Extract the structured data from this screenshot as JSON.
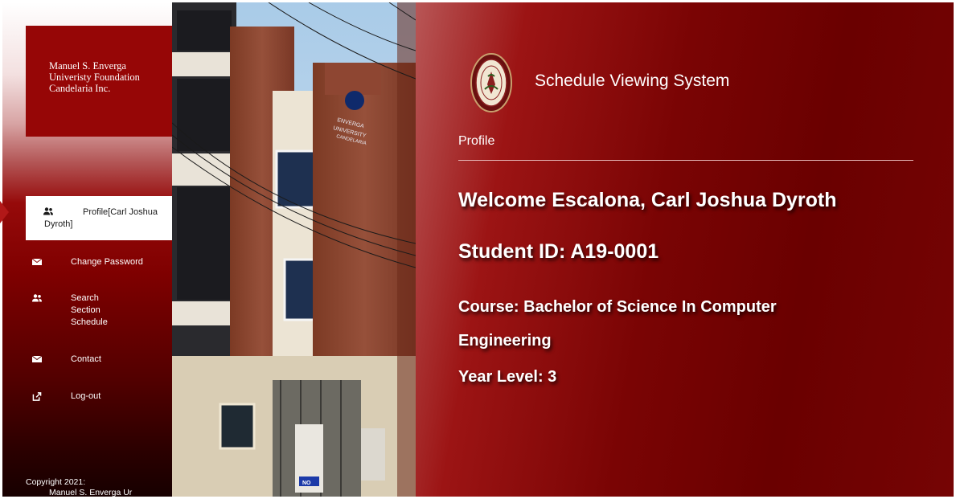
{
  "sidebar": {
    "brand_lines": [
      "Manuel S. Enverga",
      "Univeristy Foundation",
      "Candelaria Inc."
    ],
    "nav": [
      {
        "icon": "users-icon",
        "label_line1": "Profile[Carl Joshua",
        "label_line2": "Dyroth]",
        "active": true
      },
      {
        "icon": "envelope-icon",
        "label": "Change Password"
      },
      {
        "icon": "users-icon",
        "label_lines": [
          "Search",
          "Section",
          "Schedule"
        ]
      },
      {
        "icon": "envelope-icon",
        "label": "Contact"
      },
      {
        "icon": "external-link-icon",
        "label": "Log-out"
      }
    ],
    "copyright_lines": [
      "Copyright 2021:",
      "Manuel S. Enverga Ur"
    ]
  },
  "photo": {
    "building_sign": [
      "ENVERGA",
      "UNIVERSITY",
      "CANDELARIA"
    ],
    "poster_text": "NO"
  },
  "main": {
    "system_title": "Schedule Viewing System",
    "section": "Profile",
    "welcome": "Welcome Escalona, Carl Joshua Dyroth",
    "student_id": "Student ID: A19-0001",
    "course": "Course: Bachelor of Science In Computer Engineering",
    "year_level": "Year Level: 3"
  },
  "colors": {
    "brand_red": "#960606",
    "main_red": "#7a0404",
    "white": "#ffffff"
  }
}
